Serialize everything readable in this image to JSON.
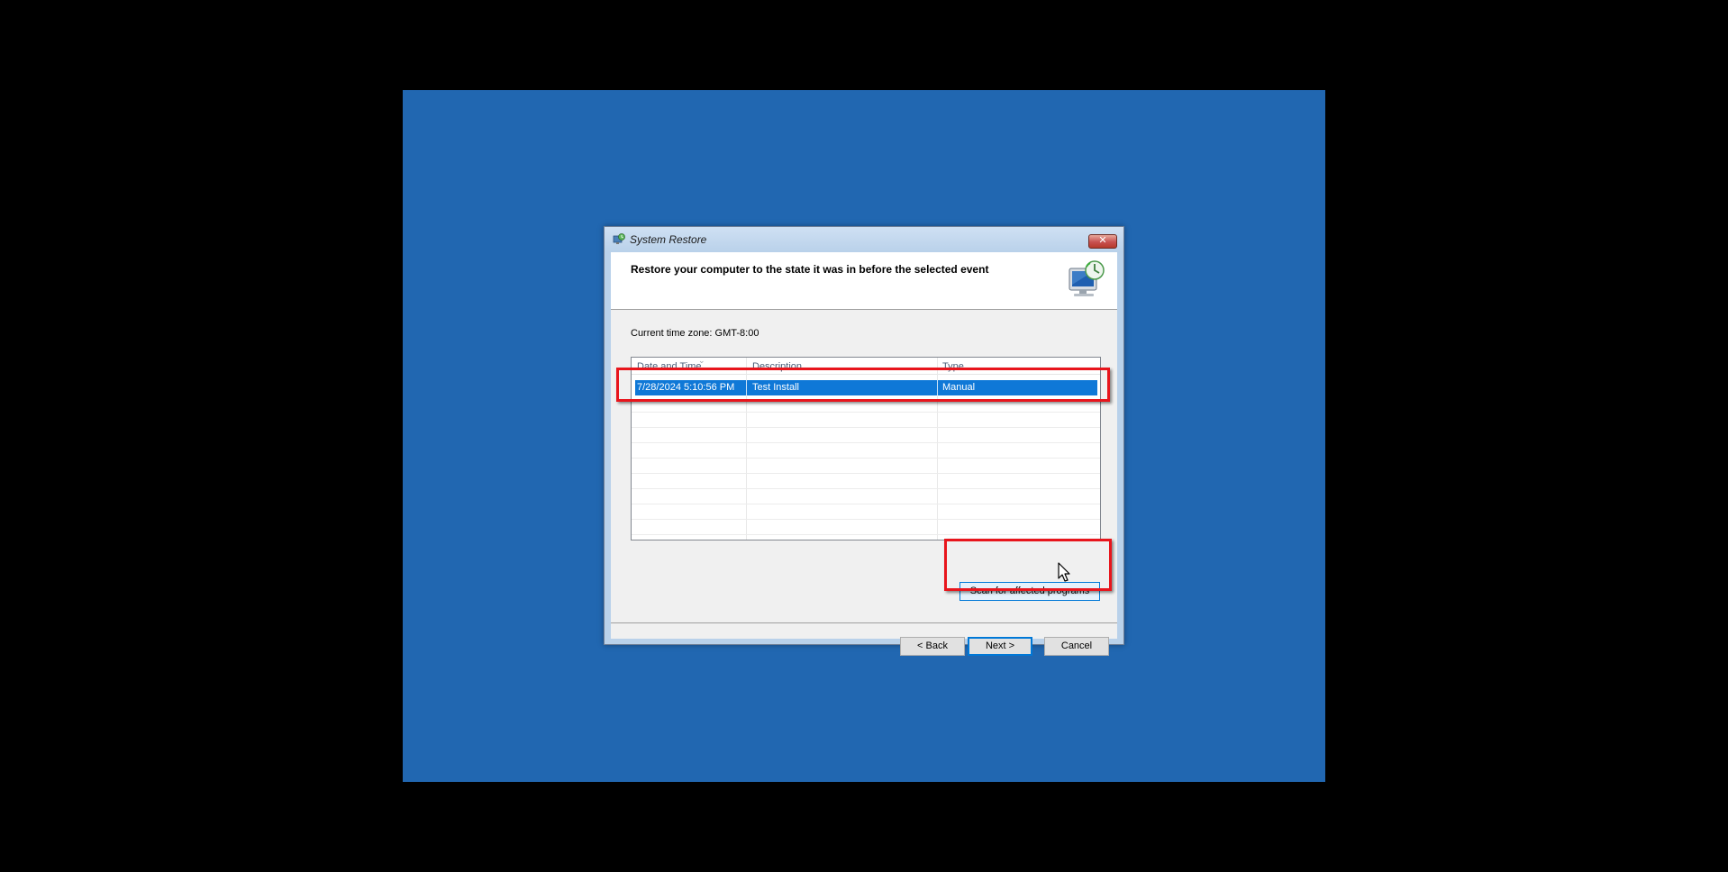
{
  "window": {
    "title": "System Restore",
    "close_label": "✕"
  },
  "header": {
    "title": "Restore your computer to the state it was in before the selected event"
  },
  "timezone": {
    "label": "Current time zone: GMT-8:00"
  },
  "restore_points": {
    "columns": [
      "Date and Time",
      "Description",
      "Type"
    ],
    "rows": [
      {
        "date_time": "7/28/2024 5:10:56 PM",
        "description": "Test Install",
        "type": "Manual",
        "selected": true
      }
    ]
  },
  "actions": {
    "scan_label": "Scan for affected programs"
  },
  "footer": {
    "back_label": "< Back",
    "next_label": "Next >",
    "cancel_label": "Cancel"
  },
  "colors": {
    "desktop_background": "#2167b1",
    "selection": "#0f78d7",
    "annotation_box": "#e8151c"
  },
  "icons": {
    "title_icon": "system-restore-icon",
    "header_icon": "computer-restore-icon",
    "cursor": "mouse-pointer-icon"
  }
}
